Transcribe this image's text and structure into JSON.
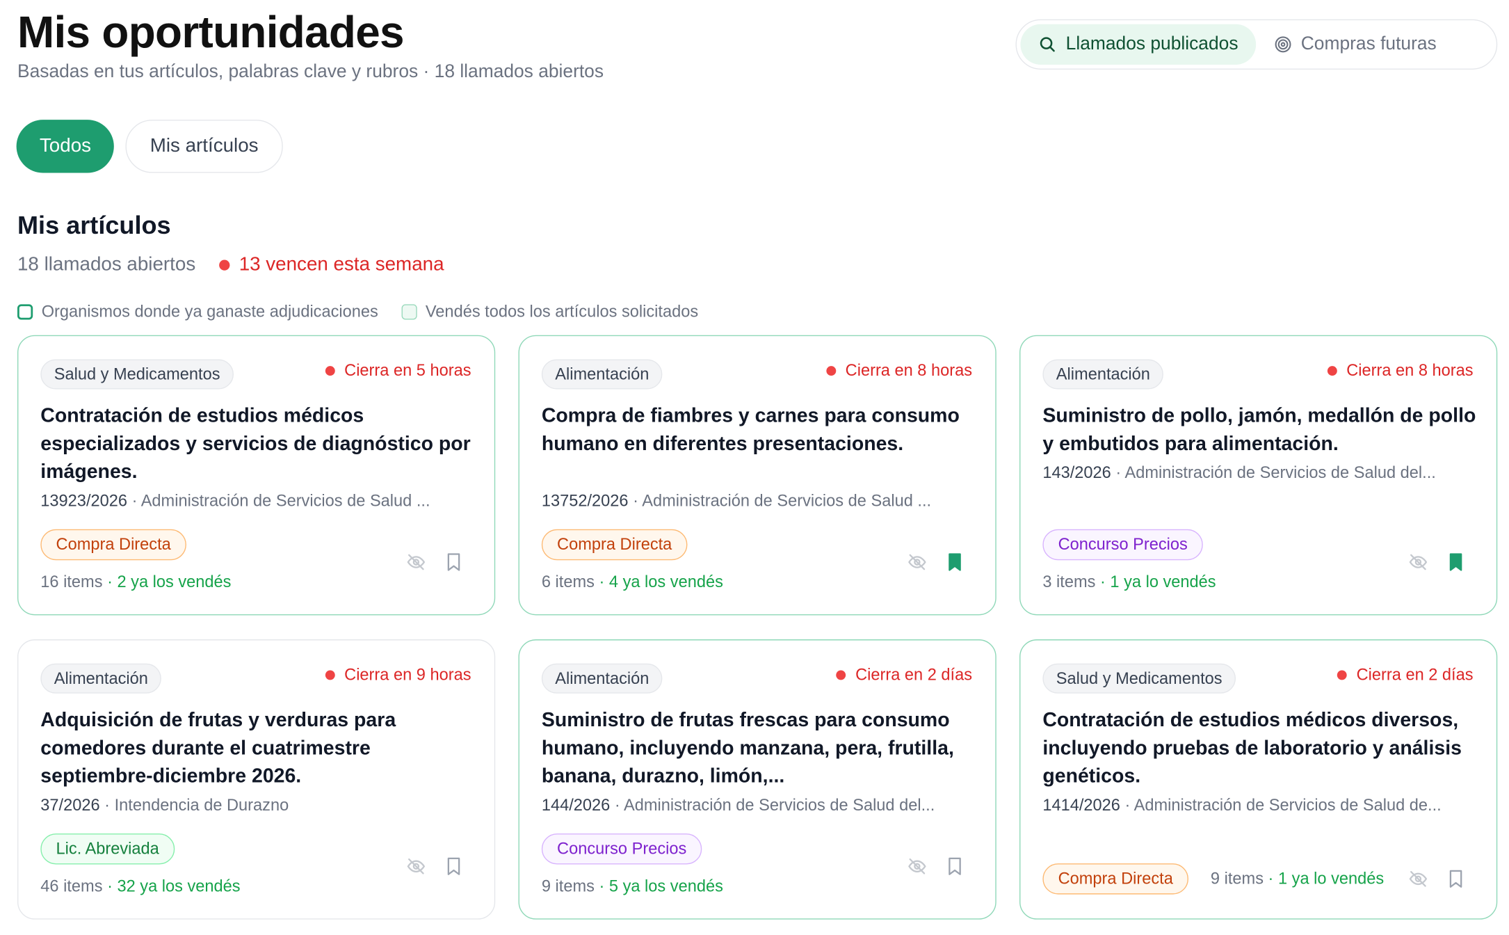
{
  "header": {
    "title": "Mis oportunidades",
    "subtitle": "Basadas en tus artículos, palabras clave y rubros · 18 llamados abiertos"
  },
  "mode_switch": {
    "published_label": "Llamados publicados",
    "published_icon": "search-icon",
    "future_label": "Compras futuras",
    "future_icon": "target-icon",
    "selected": "published"
  },
  "filters": {
    "all_label": "Todos",
    "mine_label": "Mis artículos",
    "selected": "all"
  },
  "section": {
    "title": "Mis artículos",
    "open_count": "18 llamados abiertos",
    "urgent": "13 vencen esta semana"
  },
  "legend": {
    "won_orgs": "Organismos donde ya ganaste adjudicaciones",
    "sell_all": "Vendés todos los artículos solicitados"
  },
  "colors": {
    "accent": "#1e9d6f",
    "urgent": "#dc2626",
    "card_border": "#8fd8b8",
    "sold": "#16a34a"
  },
  "cards": [
    {
      "category": "Salud y Medicamentos",
      "closes": "Cierra en 5 horas",
      "title": "Contratación de estudios médicos especializados y servicios de diagnóstico por imágenes.",
      "number": "13923/2026",
      "organism": " · Administración de Servicios de Salud ...",
      "type": "Compra Directa",
      "items": "16 items",
      "sold": " · 2 ya los vendés",
      "bookmarked": false
    },
    {
      "category": "Alimentación",
      "closes": "Cierra en 8 horas",
      "title": "Compra de fiambres y carnes para consumo humano en diferentes presentaciones.",
      "number": "13752/2026",
      "organism": " · Administración de Servicios de Salud ...",
      "type": "Compra Directa",
      "items": "6 items",
      "sold": " · 4 ya los vendés",
      "bookmarked": true
    },
    {
      "category": "Alimentación",
      "closes": "Cierra en 8 horas",
      "title": "Suministro de pollo, jamón, medallón de pollo y embutidos para alimentación.",
      "number": "143/2026",
      "organism": " · Administración de Servicios de Salud del...",
      "type": "Concurso Precios",
      "items": "3 items",
      "sold": " · 1 ya lo vendés",
      "bookmarked": true
    },
    {
      "category": "Alimentación",
      "closes": "Cierra en 9 horas",
      "title": "Adquisición de frutas y verduras para comedores durante el cuatrimestre septiembre-diciembre 2026.",
      "number": "37/2026",
      "organism": " · Intendencia de Durazno",
      "type": "Lic. Abreviada",
      "items": "46 items",
      "sold": " · 32 ya los vendés",
      "bookmarked": false
    },
    {
      "category": "Alimentación",
      "closes": "Cierra en 2 días",
      "title": "Suministro de frutas frescas para consumo humano, incluyendo manzana, pera, frutilla, banana, durazno, limón,...",
      "number": "144/2026",
      "organism": " · Administración de Servicios de Salud del...",
      "type": "Concurso Precios",
      "items": "9 items",
      "sold": " · 5 ya los vendés",
      "bookmarked": false
    },
    {
      "category": "Salud y Medicamentos",
      "closes": "Cierra en 2 días",
      "title": "Contratación de estudios médicos diversos, incluyendo pruebas de laboratorio y análisis genéticos.",
      "number": "1414/2026",
      "organism": " · Administración de Servicios de Salud de...",
      "type": "Compra Directa",
      "items": "9 items",
      "sold": " · 1 ya lo vendés",
      "bookmarked": false
    }
  ]
}
